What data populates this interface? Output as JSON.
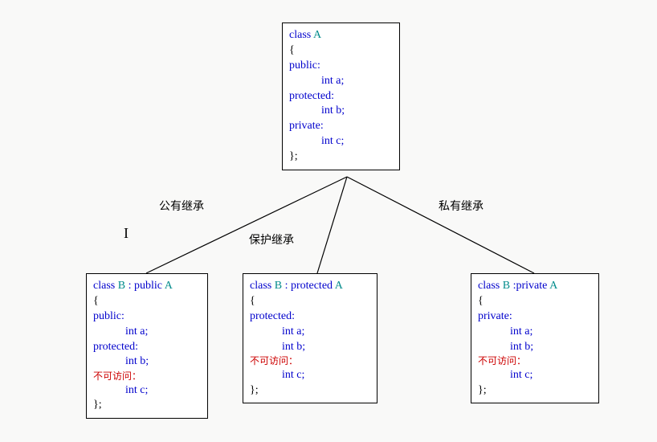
{
  "top": {
    "decl_pre": "class ",
    "name": "A",
    "open": "{",
    "sec1": "public:",
    "m1": "int a;",
    "sec2": "protected:",
    "m2": "int b;",
    "sec3": "private:",
    "m3": "int c;",
    "close": "};"
  },
  "labels": {
    "left": "公有继承",
    "mid": "保护继承",
    "right": "私有继承"
  },
  "left": {
    "decl_pre": "class ",
    "name": "B",
    "decl_mid": " : public ",
    "base": "A",
    "open": "{",
    "sec1": "public:",
    "m1": "int a;",
    "sec2": "protected:",
    "m2": "int b;",
    "noaccess": "不可访问：",
    "m3": "int c;",
    "close": "};"
  },
  "mid": {
    "decl_pre": "class ",
    "name": "B",
    "decl_mid": " : protected ",
    "base": "A",
    "open": "{",
    "sec1": "protected:",
    "m1": "int a;",
    "m2": "int b;",
    "noaccess": "不可访问：",
    "m3": "int c;",
    "close": "};"
  },
  "right": {
    "decl_pre": "class ",
    "name": "B",
    "decl_mid": " :private  ",
    "base": "A",
    "open": "{",
    "sec1": "private:",
    "m1": "int a;",
    "m2": "int b;",
    "noaccess": "不可访问：",
    "m3": "int c;",
    "close": "};"
  },
  "cursor": "I"
}
